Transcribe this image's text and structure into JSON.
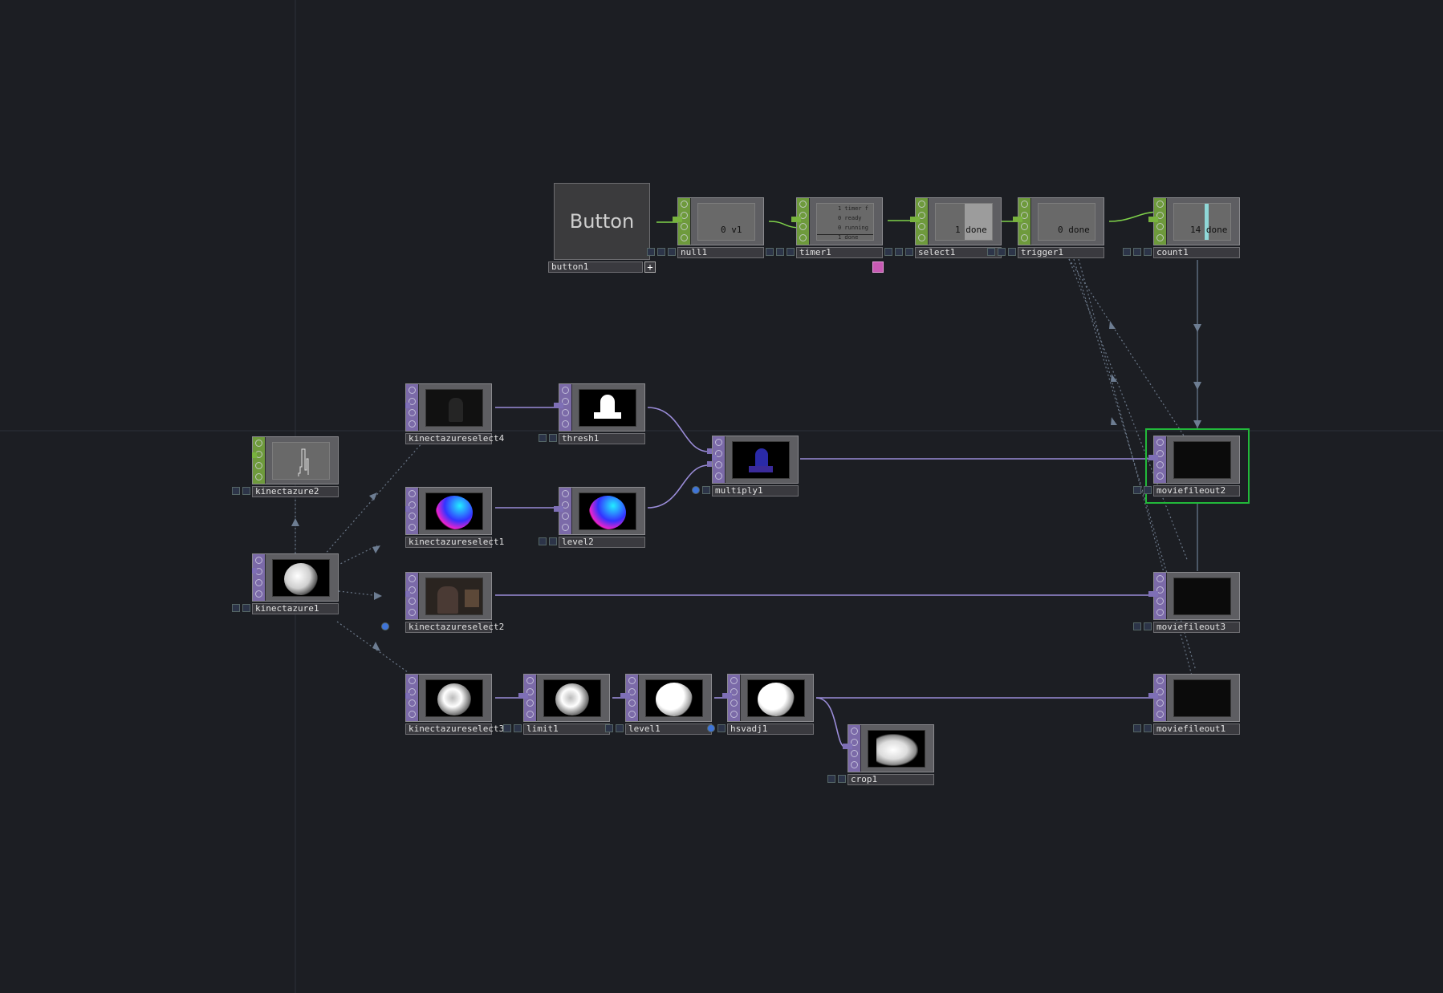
{
  "button_widget": {
    "text": "Button",
    "name": "button1"
  },
  "nodes": {
    "null1": {
      "name": "null1",
      "value": "0 v1"
    },
    "timer1": {
      "name": "timer1",
      "rows": [
        "1 timer f",
        "0 ready",
        "0 running",
        "1 done"
      ]
    },
    "select1": {
      "name": "select1",
      "value": "1 done"
    },
    "trigger1": {
      "name": "trigger1",
      "value": "0 done"
    },
    "count1": {
      "name": "count1",
      "value": "14 done"
    },
    "kinectazure2": {
      "name": "kinectazure2"
    },
    "kinectazure1": {
      "name": "kinectazure1"
    },
    "kinectazureselect4": {
      "name": "kinectazureselect4"
    },
    "kinectazureselect1": {
      "name": "kinectazureselect1"
    },
    "kinectazureselect2": {
      "name": "kinectazureselect2"
    },
    "kinectazureselect3": {
      "name": "kinectazureselect3"
    },
    "thresh1": {
      "name": "thresh1"
    },
    "level2": {
      "name": "level2"
    },
    "multiply1": {
      "name": "multiply1"
    },
    "limit1": {
      "name": "limit1"
    },
    "level1": {
      "name": "level1"
    },
    "hsvadj1": {
      "name": "hsvadj1"
    },
    "crop1": {
      "name": "crop1"
    },
    "moviefileout2": {
      "name": "moviefileout2"
    },
    "moviefileout3": {
      "name": "moviefileout3"
    },
    "moviefileout1": {
      "name": "moviefileout1"
    }
  },
  "colors": {
    "background": "#1c1e23",
    "top_family": "#7b6aa8",
    "chop_family": "#6e9a3c",
    "top_wire": "#9a8cd8",
    "chop_wire": "#7fd24a",
    "selected": "#22b93a"
  }
}
